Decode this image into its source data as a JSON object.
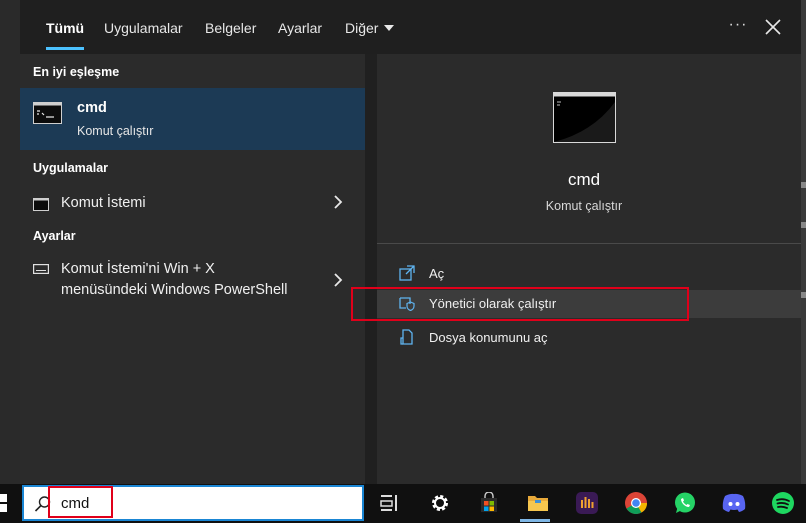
{
  "tabs": [
    {
      "label": "Tümü",
      "active": true
    },
    {
      "label": "Uygulamalar"
    },
    {
      "label": "Belgeler"
    },
    {
      "label": "Ayarlar"
    },
    {
      "label": "Diğer"
    }
  ],
  "header_icons": {
    "more": "more-icon",
    "close": "close-icon"
  },
  "left": {
    "best_match_heading": "En iyi eşleşme",
    "best_match": {
      "title": "cmd",
      "subtitle": "Komut çalıştır",
      "icon": "terminal-icon"
    },
    "apps_heading": "Uygulamalar",
    "apps": [
      {
        "label": "Komut İstemi",
        "icon": "terminal-icon"
      }
    ],
    "settings_heading": "Ayarlar",
    "settings": [
      {
        "label_line1": "Komut İstemi'ni Win + X",
        "label_line2": "menüsündeki Windows PowerShell",
        "icon": "keyboard-icon"
      }
    ]
  },
  "right": {
    "title": "cmd",
    "subtitle": "Komut çalıştır",
    "actions": [
      {
        "label": "Aç",
        "icon": "open-icon"
      },
      {
        "label": "Yönetici olarak çalıştır",
        "icon": "shield-icon"
      },
      {
        "label": "Dosya konumunu aç",
        "icon": "folder-location-icon"
      }
    ]
  },
  "search": {
    "value": "cmd"
  },
  "taskbar_icons": [
    "task-view-icon",
    "settings-gear-icon",
    "store-icon",
    "file-explorer-icon",
    "audio-app-icon",
    "chrome-icon",
    "whatsapp-icon",
    "discord-icon",
    "spotify-icon"
  ],
  "colors": {
    "accent": "#4cc2ff",
    "highlight": "#e0001a",
    "selection": "#1c3a55"
  }
}
